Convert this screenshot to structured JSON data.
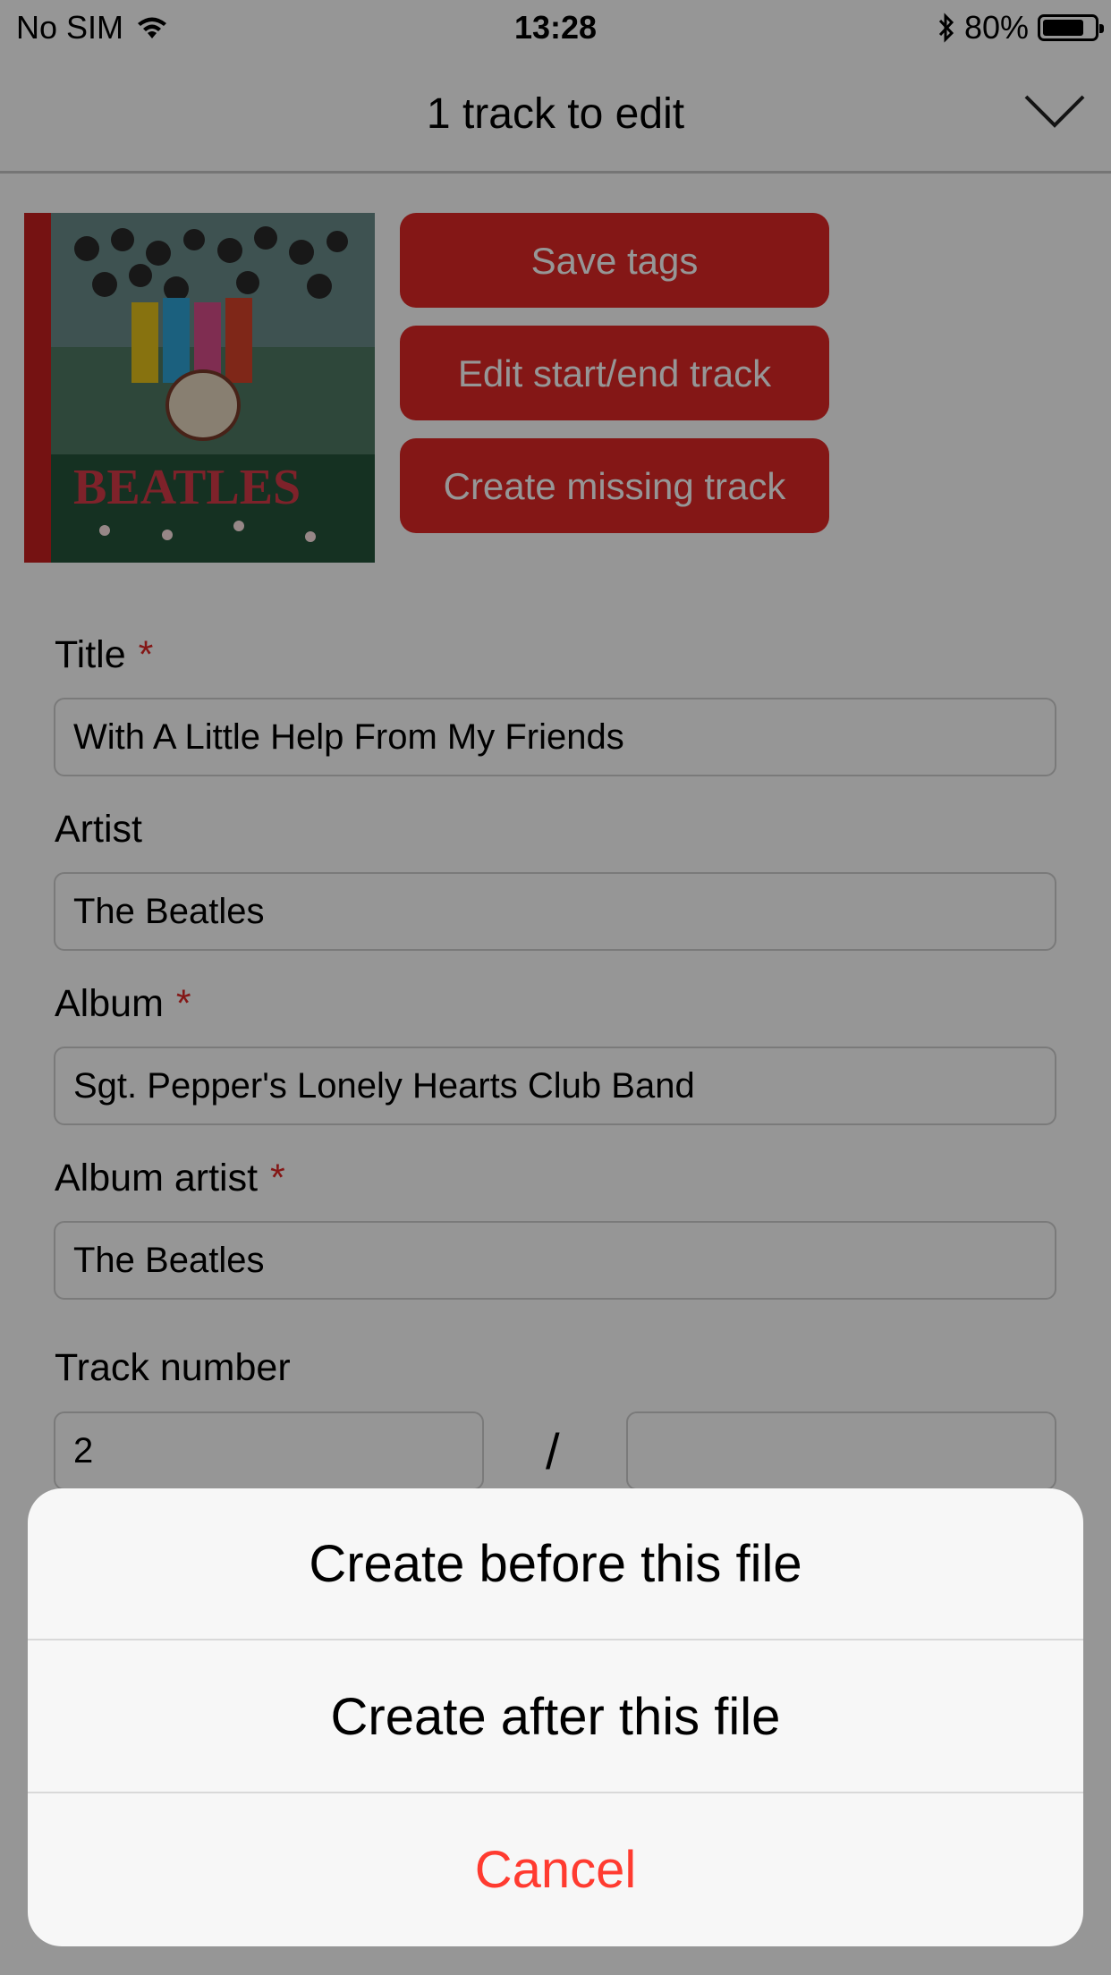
{
  "status_bar": {
    "carrier": "No SIM",
    "time": "13:28",
    "battery": "80%",
    "battery_level": 0.8
  },
  "nav": {
    "title": "1 track to edit",
    "close_icon": "chevron-down-icon"
  },
  "actions": {
    "save_label": "Save tags",
    "edit_label": "Edit start/end track",
    "create_label": "Create missing track"
  },
  "form": {
    "title_label": "Title",
    "title_value": "With A Little Help From My Friends",
    "artist_label": "Artist",
    "artist_value": "The Beatles",
    "album_label": "Album",
    "album_value": "Sgt. Pepper's Lonely Hearts Club Band",
    "album_artist_label": "Album artist",
    "album_artist_value": "The Beatles",
    "track_label": "Track number",
    "track_value": "2",
    "track_total": "",
    "required_mark": "*",
    "separator": "/"
  },
  "sheet": {
    "before": "Create before this file",
    "after": "Create after this file",
    "cancel": "Cancel"
  },
  "colors": {
    "accent": "#e02826",
    "cancel": "#ff3b30"
  }
}
